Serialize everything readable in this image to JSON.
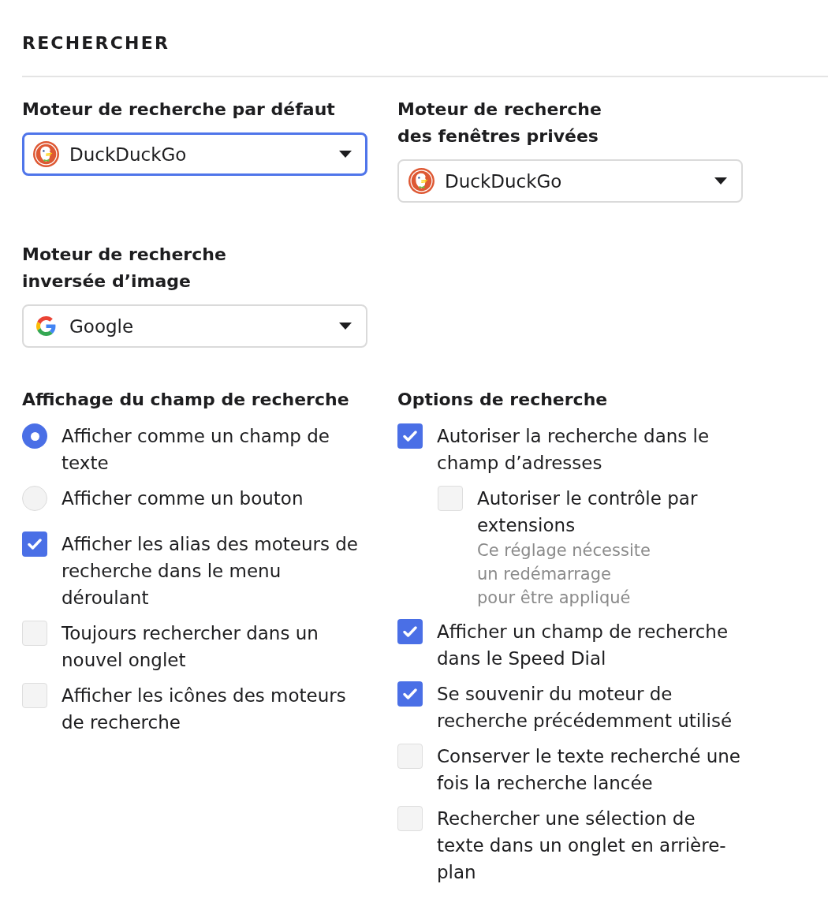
{
  "section_title": "RECHERCHER",
  "engines": [
    {
      "label": "Moteur de recherche par défaut",
      "value": "DuckDuckGo",
      "kind": "duck",
      "focused": true
    },
    {
      "label": "Moteur de recherche\ndes fenêtres privées",
      "value": "DuckDuckGo",
      "kind": "duck",
      "focused": false
    },
    {
      "label": "Moteur de recherche\ninversée d’image",
      "value": "Google",
      "kind": "g",
      "focused": false
    }
  ],
  "sections": [
    {
      "title": "Affichage du champ de recherche",
      "items": [
        {
          "kind": "radio",
          "label": "Afficher comme un champ de texte",
          "selected": true
        },
        {
          "kind": "radio",
          "label": "Afficher comme un bouton",
          "selected": false
        },
        {
          "kind": "checkbox",
          "label": "Afficher les alias des moteurs de recherche dans le menu déroulant",
          "checked": true
        },
        {
          "kind": "checkbox",
          "label": "Toujours rechercher dans un nouvel onglet",
          "checked": false
        },
        {
          "kind": "checkbox",
          "label": "Afficher les icônes des moteurs de recherche",
          "checked": false
        }
      ]
    },
    {
      "title": "Options de recherche",
      "items": [
        {
          "kind": "checkbox",
          "label": "Autoriser la recherche dans le champ d’adresses",
          "checked": true,
          "children": [
            {
              "kind": "checkbox",
              "label": "Autoriser le contrôle par extensions",
              "checked": false,
              "note": "Ce réglage nécessite\nun redémarrage\npour être appliqué"
            }
          ]
        },
        {
          "kind": "checkbox",
          "label": "Afficher un champ de recherche dans le Speed Dial",
          "checked": true
        },
        {
          "kind": "checkbox",
          "label": "Se souvenir du moteur de recherche précédemment utilisé",
          "checked": true
        },
        {
          "kind": "checkbox",
          "label": "Conserver le texte recherché une fois la recherche lancée",
          "checked": false
        },
        {
          "kind": "checkbox",
          "label": "Rechercher une sélection de texte dans un onglet en arrière-plan",
          "checked": false
        }
      ]
    }
  ]
}
